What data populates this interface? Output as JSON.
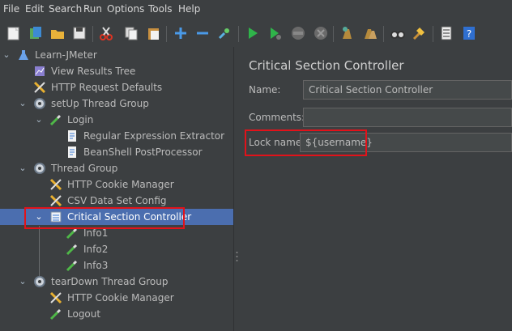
{
  "menubar": {
    "items": [
      "File",
      "Edit",
      "Search",
      "Run",
      "Options",
      "Tools",
      "Help"
    ]
  },
  "toolbar": {
    "icons": [
      "new-icon",
      "templates-icon",
      "open-icon",
      "save-icon",
      "cut-icon",
      "copy-icon",
      "paste-icon",
      "expand-icon",
      "collapse-icon",
      "toggle-icon",
      "start-icon",
      "start-no-pauses-icon",
      "stop-icon",
      "shutdown-icon",
      "clear-icon",
      "clear-all-icon",
      "search-icon",
      "reset-search-icon",
      "function-helper-icon",
      "help-icon"
    ]
  },
  "tree": {
    "nodes": [
      {
        "label": "Learn-JMeter",
        "icon": "flask-icon",
        "expanded": true
      },
      {
        "label": "View Results Tree",
        "icon": "chart-icon"
      },
      {
        "label": "HTTP Request Defaults",
        "icon": "wrench-icon"
      },
      {
        "label": "setUp Thread Group",
        "icon": "gear-icon",
        "expanded": true
      },
      {
        "label": "Login",
        "icon": "pipette-icon",
        "expanded": true
      },
      {
        "label": "Regular Expression Extractor",
        "icon": "document-icon"
      },
      {
        "label": "BeanShell PostProcessor",
        "icon": "document-icon"
      },
      {
        "label": "Thread Group",
        "icon": "gear-icon",
        "expanded": true
      },
      {
        "label": "HTTP Cookie Manager",
        "icon": "wrench-icon"
      },
      {
        "label": "CSV Data Set Config",
        "icon": "wrench-icon"
      },
      {
        "label": "Critical Section Controller",
        "icon": "controller-icon",
        "expanded": true,
        "selected": true
      },
      {
        "label": "Info1",
        "icon": "pipette-icon"
      },
      {
        "label": "Info2",
        "icon": "pipette-icon"
      },
      {
        "label": "Info3",
        "icon": "pipette-icon"
      },
      {
        "label": "tearDown Thread Group",
        "icon": "gear-icon",
        "expanded": true
      },
      {
        "label": "HTTP Cookie Manager",
        "icon": "wrench-icon"
      },
      {
        "label": "Logout",
        "icon": "pipette-icon"
      }
    ]
  },
  "panel": {
    "title": "Critical Section Controller",
    "name_label": "Name:",
    "name_value": "Critical Section Controller",
    "comments_label": "Comments:",
    "comments_value": "",
    "lock_label": "Lock name",
    "lock_value": "${username}"
  },
  "colors": {
    "background": "#3c3f41",
    "selection": "#4b6eaf",
    "highlight_box": "#e2121a",
    "field_bg": "#45494a"
  }
}
